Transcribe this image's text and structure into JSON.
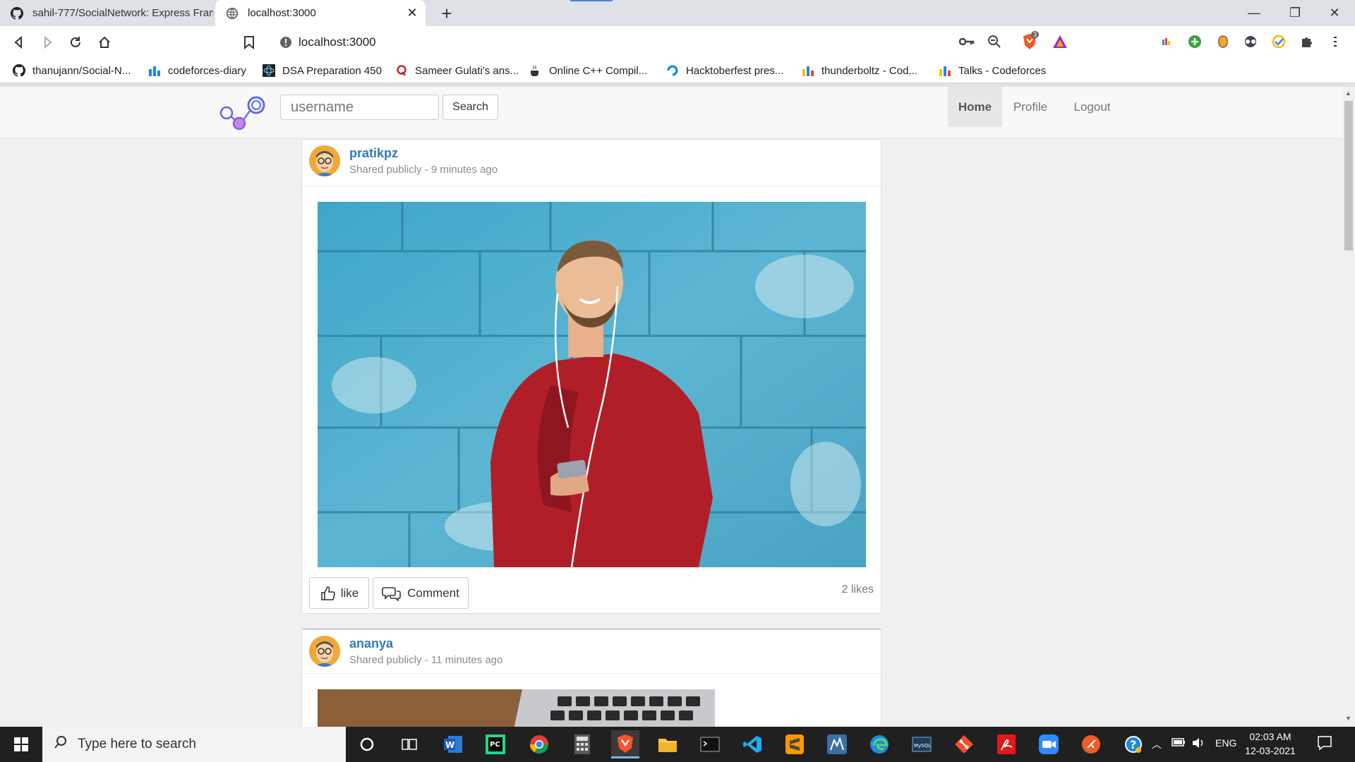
{
  "browser": {
    "tabs": [
      {
        "title": "sahil-777/SocialNetwork: Express Fram"
      },
      {
        "title": "localhost:3000"
      }
    ],
    "address": "localhost:3000",
    "extension_badge": "3",
    "bookmarks": [
      {
        "label": "thanujann/Social-N..."
      },
      {
        "label": "codeforces-diary"
      },
      {
        "label": "DSA Preparation 450"
      },
      {
        "label": "Sameer Gulati's ans..."
      },
      {
        "label": "Online C++ Compil..."
      },
      {
        "label": "Hacktoberfest pres..."
      },
      {
        "label": "thunderboltz - Cod..."
      },
      {
        "label": "Talks - Codeforces"
      }
    ]
  },
  "app": {
    "search": {
      "placeholder": "username",
      "button": "Search"
    },
    "nav": [
      {
        "label": "Home"
      },
      {
        "label": "Profile"
      },
      {
        "label": "Logout"
      }
    ],
    "posts": [
      {
        "user": "pratikpz",
        "meta": "Shared publicly - 9 minutes ago",
        "like_label": "like",
        "comment_label": "Comment",
        "likes": "2 likes"
      },
      {
        "user": "ananya",
        "meta": "Shared publicly - 11 minutes ago"
      }
    ]
  },
  "taskbar": {
    "search_placeholder": "Type here to search",
    "lang": "ENG",
    "time": "02:03 AM",
    "date": "12-03-2021"
  },
  "colors": {
    "link": "#337ab7",
    "navbar": "#f8f8f8",
    "page_bg": "#f0f0f0"
  }
}
